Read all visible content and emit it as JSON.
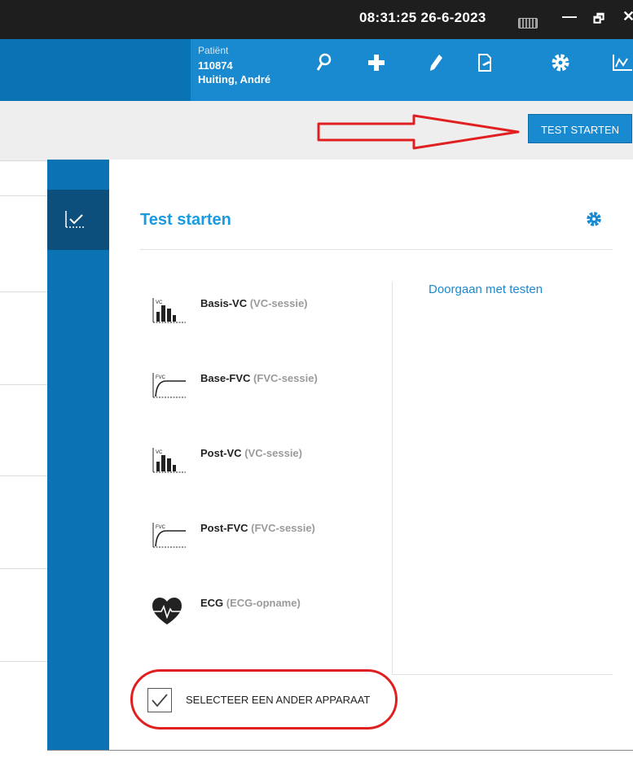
{
  "titlebar": {
    "clock": "08:31:25 26-6-2023",
    "keyboard_icon": "keyboard-icon",
    "minimize": "—",
    "restore": "🗗",
    "close": "✕"
  },
  "patient": {
    "label": "Patiënt",
    "id": "110874",
    "name": "Huiting, André"
  },
  "toolbar": {
    "icons": [
      "search-icon",
      "plus-icon",
      "pen-icon",
      "document-edit-icon",
      "gear-icon",
      "chart-icon"
    ]
  },
  "actionbar": {
    "start_button": "TEST STARTEN"
  },
  "modal": {
    "title": "Test starten",
    "continue_link": "Doorgaan met testen",
    "tests": [
      {
        "name": "Basis-VC",
        "session": "(VC-sessie)",
        "icon": "vc-bar-chart-icon"
      },
      {
        "name": "Base-FVC",
        "session": "(FVC-sessie)",
        "icon": "fvc-curve-icon"
      },
      {
        "name": "Post-VC",
        "session": "(VC-sessie)",
        "icon": "vc-bar-chart-icon"
      },
      {
        "name": "Post-FVC",
        "session": "(FVC-sessie)",
        "icon": "fvc-curve-icon"
      },
      {
        "name": "ECG",
        "session": "(ECG-opname)",
        "icon": "heart-ecg-icon"
      }
    ],
    "select_device": "SELECTEER EEN ANDER APPARAAT",
    "select_device_checked": true
  },
  "colors": {
    "accent": "#1a8ad0",
    "appbar": "#0a73b4",
    "annotation": "#e02020"
  }
}
